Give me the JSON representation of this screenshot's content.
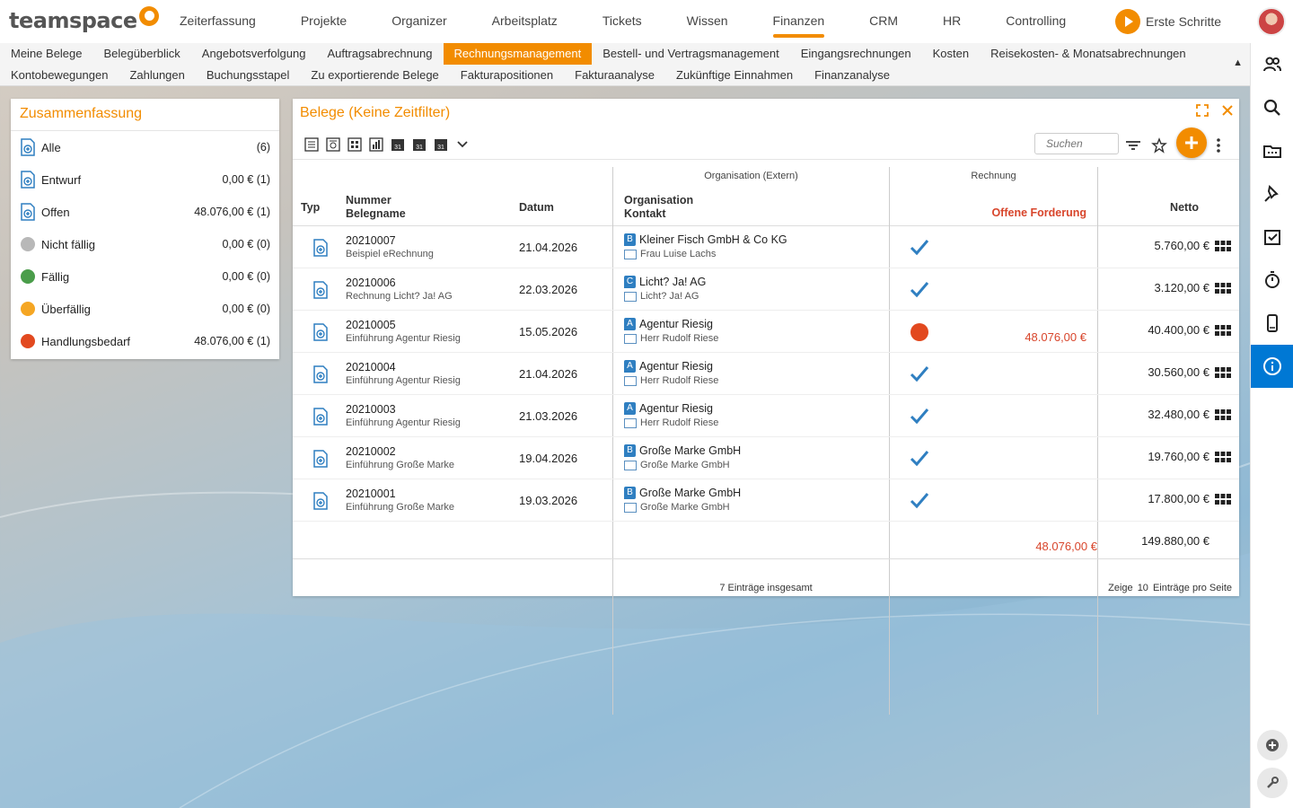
{
  "app": {
    "logo_text": "teamspace"
  },
  "topnav": {
    "items": [
      "Zeiterfassung",
      "Projekte",
      "Organizer",
      "Arbeitsplatz",
      "Tickets",
      "Wissen",
      "Finanzen",
      "CRM",
      "HR",
      "Controlling"
    ],
    "active": "Finanzen",
    "erste_schritte": "Erste Schritte"
  },
  "subnav": {
    "row1": [
      "Meine Belege",
      "Belegüberblick",
      "Angebotsverfolgung",
      "Auftragsabrechnung",
      "Rechnungsmanagement",
      "Bestell- und Vertragsmanagement",
      "Eingangsrechnungen",
      "Kosten",
      "Reisekosten- & Monatsabrechnungen"
    ],
    "row2": [
      "Kontobewegungen",
      "Zahlungen",
      "Buchungsstapel",
      "Zu exportierende Belege",
      "Fakturapositionen",
      "Fakturaanalyse",
      "Zukünftige Einnahmen",
      "Finanzanalyse"
    ],
    "active": "Rechnungsmanagement",
    "collapse_glyph": "▲"
  },
  "summary": {
    "title": "Zusammenfassung",
    "rows": [
      {
        "label": "Alle",
        "value": "(6)",
        "icon": "doc-icon"
      },
      {
        "label": "Entwurf",
        "value": "0,00 € (1)",
        "icon": "doc-edit-icon"
      },
      {
        "label": "Offen",
        "value": "48.076,00 € (1)",
        "icon": "doc-icon"
      },
      {
        "label": "Nicht fällig",
        "value": "0,00 € (0)",
        "color": "#b8b8b8"
      },
      {
        "label": "Fällig",
        "value": "0,00 € (0)",
        "color": "#4a9d4a"
      },
      {
        "label": "Überfällig",
        "value": "0,00 € (0)",
        "color": "#f5a623"
      },
      {
        "label": "Handlungsbedarf",
        "value": "48.076,00 € (1)",
        "color": "#e2491f"
      }
    ]
  },
  "belege": {
    "title": "Belege (Keine Zeitfilter)",
    "search_placeholder": "Suchen",
    "headers": {
      "typ": "Typ",
      "nummer": "Nummer",
      "belegname": "Belegname",
      "datum": "Datum",
      "org_group": "Organisation (Extern)",
      "organisation": "Organisation",
      "kontakt": "Kontakt",
      "rechnung_group": "Rechnung",
      "offene_forderung": "Offene Forderung",
      "netto": "Netto"
    },
    "rows": [
      {
        "nummer": "20210007",
        "belegname": "Beispiel eRechnung",
        "datum": "21.04.2026",
        "org_badge": "B",
        "organisation": "Kleiner Fisch GmbH & Co KG",
        "kontakt": "Frau Luise Lachs",
        "status": "check",
        "forderung": "",
        "netto": "5.760,00 €",
        "type_icon": "e-invoice-icon"
      },
      {
        "nummer": "20210006",
        "belegname": "Rechnung Licht? Ja! AG",
        "datum": "22.03.2026",
        "org_badge": "C",
        "organisation": "Licht? Ja! AG",
        "kontakt": "Licht? Ja! AG",
        "status": "check",
        "forderung": "",
        "netto": "3.120,00 €",
        "type_icon": "invoice-icon"
      },
      {
        "nummer": "20210005",
        "belegname": "Einführung Agentur Riesig",
        "datum": "15.05.2026",
        "org_badge": "A",
        "organisation": "Agentur Riesig",
        "kontakt": "Herr Rudolf Riese",
        "status": "open",
        "forderung": "48.076,00 €",
        "netto": "40.400,00 €",
        "type_icon": "invoice-icon"
      },
      {
        "nummer": "20210004",
        "belegname": "Einführung Agentur Riesig",
        "datum": "21.04.2026",
        "org_badge": "A",
        "organisation": "Agentur Riesig",
        "kontakt": "Herr Rudolf Riese",
        "status": "check",
        "forderung": "",
        "netto": "30.560,00 €",
        "type_icon": "invoice-icon"
      },
      {
        "nummer": "20210003",
        "belegname": "Einführung Agentur Riesig",
        "datum": "21.03.2026",
        "org_badge": "A",
        "organisation": "Agentur Riesig",
        "kontakt": "Herr Rudolf Riese",
        "status": "check",
        "forderung": "",
        "netto": "32.480,00 €",
        "type_icon": "invoice-export-icon"
      },
      {
        "nummer": "20210002",
        "belegname": "Einführung Große Marke",
        "datum": "19.04.2026",
        "org_badge": "B",
        "organisation": "Große Marke GmbH",
        "kontakt": "Große Marke GmbH",
        "status": "check",
        "forderung": "",
        "netto": "19.760,00 €",
        "type_icon": "invoice-icon"
      },
      {
        "nummer": "20210001",
        "belegname": "Einführung Große Marke",
        "datum": "19.03.2026",
        "org_badge": "B",
        "organisation": "Große Marke GmbH",
        "kontakt": "Große Marke GmbH",
        "status": "check",
        "forderung": "",
        "netto": "17.800,00 €",
        "type_icon": "invoice-icon"
      }
    ],
    "totals": {
      "forderung": "48.076,00 €",
      "netto": "149.880,00 €"
    },
    "footer": {
      "total_entries": "7 Einträge insgesamt",
      "zeige": "Zeige",
      "per_page": "10",
      "per_page_suffix": "Einträge pro Seite"
    }
  },
  "colors": {
    "accent": "#f28c00",
    "blue": "#2f7fc1",
    "red": "#d8452b",
    "active_sidebar": "#0078d4"
  }
}
